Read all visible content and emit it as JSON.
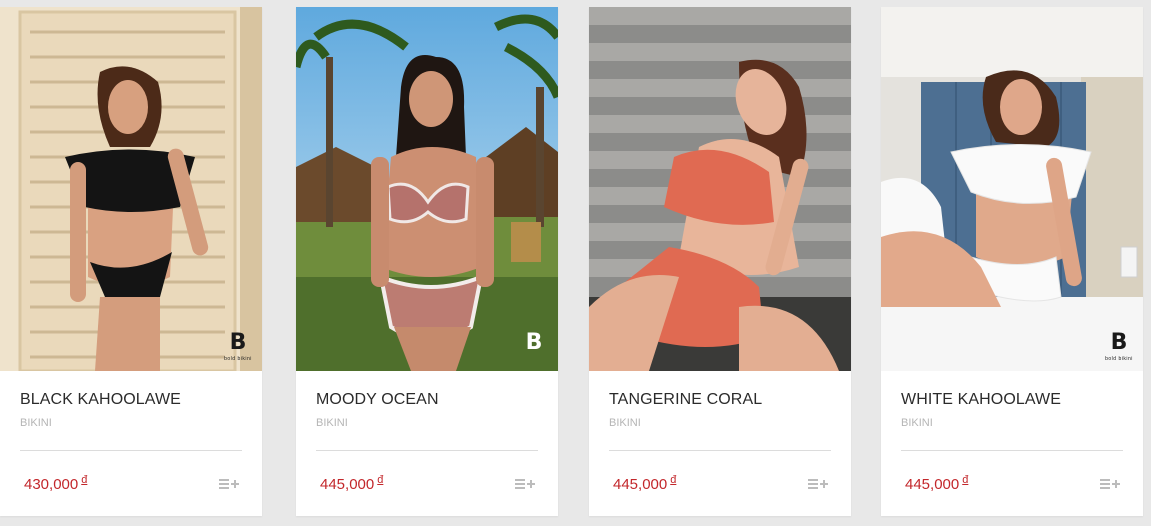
{
  "brand_mark": {
    "letter": "B",
    "text": "bold bikini"
  },
  "products": [
    {
      "name": "MOODY OCEAN",
      "category": "BIKINI",
      "price": "445,000",
      "currency": "đ",
      "add_icon": "add-to-list-icon"
    },
    {
      "name": "TANGERINE CORAL",
      "category": "BIKINI",
      "price": "445,000",
      "currency": "đ",
      "add_icon": "add-to-list-icon"
    },
    {
      "name": "WHITE KAHOOLAWE",
      "category": "BIKINI",
      "price": "445,000",
      "currency": "đ",
      "add_icon": "add-to-list-icon"
    },
    {
      "name": "BLACK KAHOOLAWE",
      "category": "BIKINI",
      "price": "430,000",
      "currency": "đ",
      "add_icon": "add-to-list-icon"
    }
  ],
  "colors": {
    "price": "#c3272b",
    "background": "#e8e8e8",
    "muted": "#b5b5b5"
  }
}
